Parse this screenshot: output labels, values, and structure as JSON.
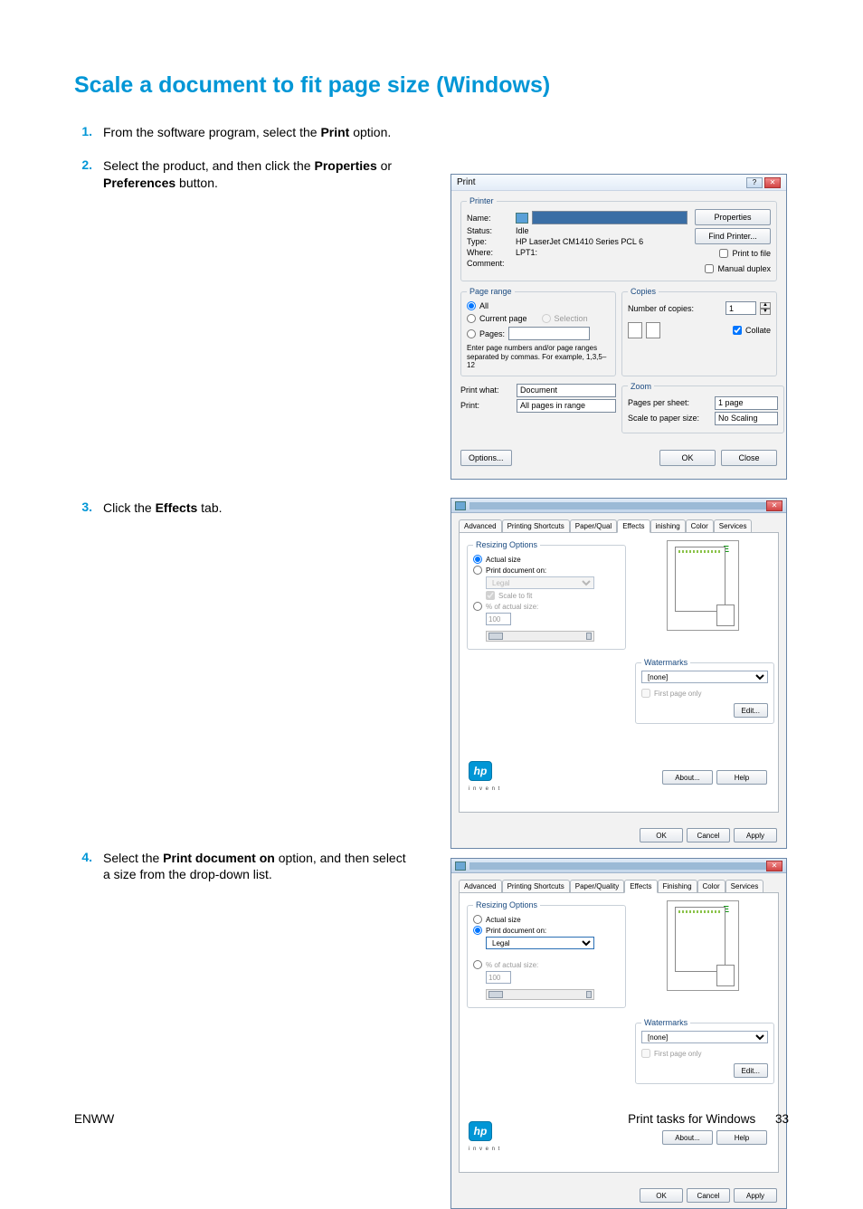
{
  "heading": "Scale a document to fit page size (Windows)",
  "steps": {
    "s1": {
      "num": "1.",
      "textA": "From the software program, select the ",
      "bold1": "Print",
      "textB": " option."
    },
    "s2": {
      "num": "2.",
      "textA": "Select the product, and then click the ",
      "bold1": "Properties",
      "textB": " or ",
      "bold2": "Preferences",
      "textC": " button."
    },
    "s3": {
      "num": "3.",
      "textA": "Click the ",
      "bold1": "Effects",
      "textB": " tab."
    },
    "s4": {
      "num": "4.",
      "textA": "Select the ",
      "bold1": "Print document on",
      "textB": " option, and then select a size from the drop-down list."
    }
  },
  "printDlg": {
    "title": "Print",
    "printer": {
      "legend": "Printer",
      "name_lbl": "Name:",
      "status_lbl": "Status:",
      "status_val": "Idle",
      "type_lbl": "Type:",
      "type_val": "HP LaserJet CM1410 Series PCL 6",
      "where_lbl": "Where:",
      "where_val": "LPT1:",
      "comment_lbl": "Comment:",
      "properties_btn": "Properties",
      "findprinter_btn": "Find Printer...",
      "printtofile_ck": "Print to file",
      "manualduplex_ck": "Manual duplex"
    },
    "pagerange": {
      "legend": "Page range",
      "all": "All",
      "current": "Current page",
      "selection": "Selection",
      "pages": "Pages:",
      "hint": "Enter page numbers and/or page ranges separated by commas. For example, 1,3,5–12"
    },
    "copies": {
      "legend": "Copies",
      "numcopies_lbl": "Number of copies:",
      "numcopies_val": "1",
      "collate": "Collate"
    },
    "printwhat": {
      "lbl": "Print what:",
      "val": "Document"
    },
    "print": {
      "lbl": "Print:",
      "val": "All pages in range"
    },
    "zoom": {
      "legend": "Zoom",
      "pps_lbl": "Pages per sheet:",
      "pps_val": "1 page",
      "sps_lbl": "Scale to paper size:",
      "sps_val": "No Scaling"
    },
    "options_btn": "Options...",
    "ok_btn": "OK",
    "close_btn": "Close"
  },
  "propDlg": {
    "tabs": {
      "adv": "Advanced",
      "short": "Printing Shortcuts",
      "pq": "Paper/Qual",
      "pq2": "Paper/Quality",
      "eff": "Effects",
      "fin": "Finishing",
      "fin_short": "inishing",
      "color": "Color",
      "serv": "Services"
    },
    "resize": {
      "legend": "Resizing Options",
      "actual": "Actual size",
      "printon": "Print document on:",
      "printon_val": "Legal",
      "scalefit": "Scale to fit",
      "pct": "% of actual size:",
      "pct_val": "100"
    },
    "watermarks": {
      "legend": "Watermarks",
      "val": "[none]",
      "firstpage": "First page only",
      "edit": "Edit..."
    },
    "about": "About...",
    "help": "Help",
    "ok": "OK",
    "cancel": "Cancel",
    "apply": "Apply",
    "hp_sub": "i n v e n t"
  },
  "footer": {
    "left": "ENWW",
    "right": "Print tasks for Windows",
    "page": "33"
  }
}
